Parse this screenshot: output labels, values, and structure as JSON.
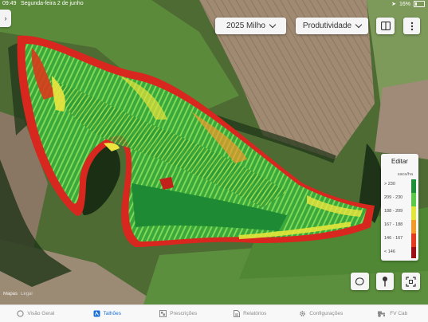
{
  "status": {
    "time": "09:49",
    "date": "Segunda-feira 2 de junho",
    "battery": "16%"
  },
  "season_select": {
    "label": "2025 Milho"
  },
  "layer_select": {
    "label": "Produtividade"
  },
  "legend": {
    "edit_label": "Editar",
    "unit": "saca/ha",
    "entries": [
      {
        "label": "> 230",
        "color": "#1f8f3a"
      },
      {
        "label": "209 - 230",
        "color": "#5cc94a"
      },
      {
        "label": "188 - 209",
        "color": "#e3e63a"
      },
      {
        "label": "167 - 188",
        "color": "#f39a2c"
      },
      {
        "label": "146 - 167",
        "color": "#e23b1f"
      },
      {
        "label": "< 146",
        "color": "#9b0f16"
      }
    ]
  },
  "map_credit": {
    "brand": "Mapas",
    "legal": "Legal"
  },
  "tabs": [
    {
      "label": "Visão Geral",
      "icon": "circle-icon",
      "active": false
    },
    {
      "label": "Talhões",
      "icon": "field-icon",
      "active": true
    },
    {
      "label": "Prescrições",
      "icon": "prescription-icon",
      "active": false
    },
    {
      "label": "Relatórios",
      "icon": "report-icon",
      "active": false
    },
    {
      "label": "Configurações",
      "icon": "gear-icon",
      "active": false
    },
    {
      "label": "FV Cab",
      "icon": "tractor-icon",
      "active": false
    }
  ]
}
